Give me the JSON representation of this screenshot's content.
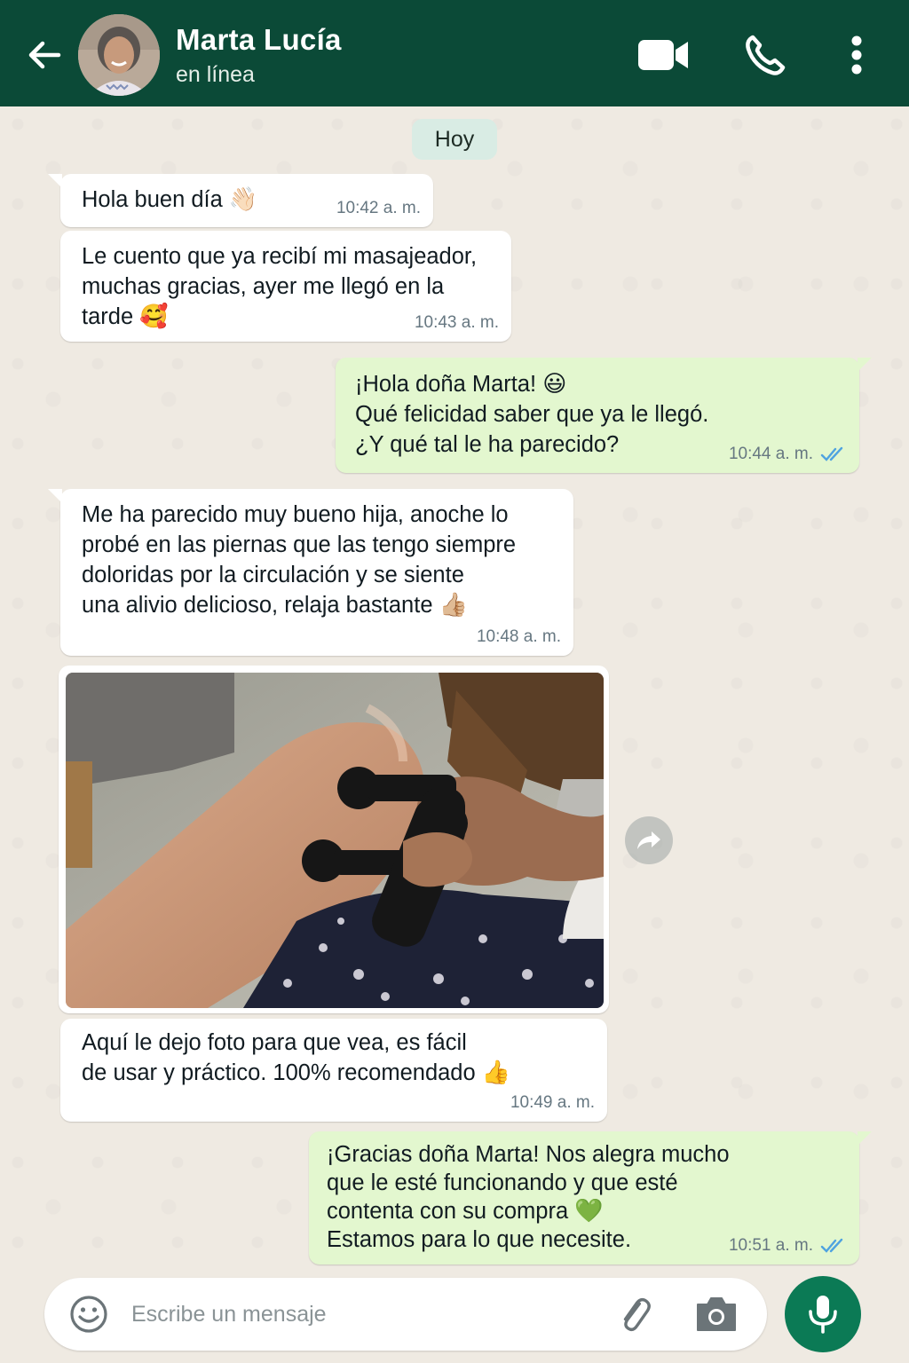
{
  "header": {
    "contact_name": "Marta Lucía",
    "status": "en línea",
    "background_color": "#0b4a37",
    "icons": [
      "back-arrow-icon",
      "video-call-icon",
      "phone-call-icon",
      "more-options-icon"
    ]
  },
  "chat": {
    "day_chip": "Hoy",
    "messages": [
      {
        "direction": "in",
        "text": "Hola buen día",
        "emoji": "👋🏻",
        "time": "10:42 a. m."
      },
      {
        "direction": "in",
        "text": "Le cuento que ya recibí mi masajeador,\nmuchas gracias, ayer me llegó en la\ntarde",
        "emoji": "🥰",
        "time": "10:43 a. m."
      },
      {
        "direction": "out",
        "text": "¡Hola doña Marta!",
        "emoji": "😃",
        "text2": "Qué felicidad saber que ya le llegó.\n¿Y qué tal le ha parecido?",
        "time": "10:44 a. m.",
        "status": "read"
      },
      {
        "direction": "in",
        "text": "Me ha parecido muy bueno hija, anoche lo\nprobé en las piernas que las tengo siempre\ndoloridas por la circulación y se siente\nuna alivio delicioso, relaja bastante",
        "emoji": "👍🏼",
        "time": "10:48 a. m."
      },
      {
        "direction": "in",
        "type": "image"
      },
      {
        "direction": "in",
        "text": "Aquí le dejo foto para que vea, es fácil\nde usar y práctico. 100% recomendado",
        "emoji": "👍",
        "time": "10:49 a. m."
      },
      {
        "direction": "out",
        "text": "¡Gracias doña Marta! Nos alegra mucho\nque le esté funcionando y que esté\ncontenta con su compra",
        "emoji": "💚",
        "text2": "Estamos para lo que necesite.",
        "time": "10:51 a. m.",
        "status": "read"
      }
    ]
  },
  "composer": {
    "placeholder": "Escribe un mensaje",
    "icons": [
      "emoji-icon",
      "attach-clip-icon",
      "camera-icon",
      "microphone-icon"
    ],
    "accent_color": "#0b7a55"
  },
  "colors": {
    "incoming_bubble": "#ffffff",
    "outgoing_bubble": "#e3f7cf",
    "read_ticks": "#4fa3e0"
  }
}
